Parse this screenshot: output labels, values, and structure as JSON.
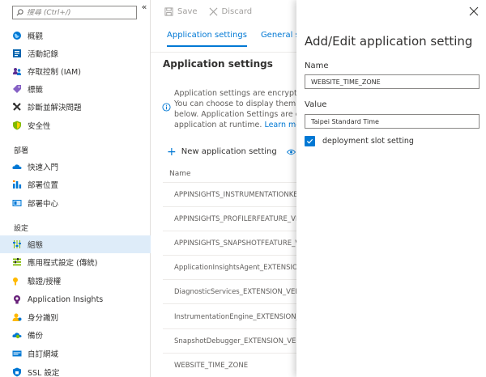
{
  "sidebar": {
    "search_placeholder": "搜尋 (Ctrl+/)",
    "collapse_glyph": "«",
    "section_deploy": "部署",
    "section_settings": "設定",
    "items": [
      {
        "label": "概觀",
        "icon": "globe-icon"
      },
      {
        "label": "活動記錄",
        "icon": "activity-log-icon"
      },
      {
        "label": "存取控制 (IAM)",
        "icon": "people-icon"
      },
      {
        "label": "標籤",
        "icon": "tag-icon"
      },
      {
        "label": "診斷並解決問題",
        "icon": "tools-icon"
      },
      {
        "label": "安全性",
        "icon": "shield-icon"
      },
      {
        "label": "快速入門",
        "icon": "cloud-icon"
      },
      {
        "label": "部署位置",
        "icon": "deployment-slots-icon"
      },
      {
        "label": "部署中心",
        "icon": "deployment-center-icon"
      },
      {
        "label": "組態",
        "icon": "sliders-icon"
      },
      {
        "label": "應用程式設定 (傳統)",
        "icon": "app-settings-icon"
      },
      {
        "label": "驗證/授權",
        "icon": "key-icon"
      },
      {
        "label": "Application Insights",
        "icon": "lightbulb-icon"
      },
      {
        "label": "身分識別",
        "icon": "identity-icon"
      },
      {
        "label": "備份",
        "icon": "backup-icon"
      },
      {
        "label": "自訂網域",
        "icon": "custom-domain-icon"
      },
      {
        "label": "SSL 設定",
        "icon": "lock-icon"
      }
    ]
  },
  "toolbar": {
    "save_label": "Save",
    "discard_label": "Discard"
  },
  "tabs": {
    "application_settings": "Application settings",
    "general_settings": "General sett"
  },
  "main": {
    "title": "Application settings",
    "info_lines": [
      "Application settings are encrypted",
      "You can choose to display them in",
      "below. Application Settings are exp",
      "application at runtime."
    ],
    "learn_more": "Learn more",
    "new_setting_label": "New application setting",
    "show_label": "Sh",
    "name_column": "Name",
    "rows": [
      "APPINSIGHTS_INSTRUMENTATIONKEY",
      "APPINSIGHTS_PROFILERFEATURE_VERSIO",
      "APPINSIGHTS_SNAPSHOTFEATURE_VERSI",
      "ApplicationInsightsAgent_EXTENSION_VI",
      "DiagnosticServices_EXTENSION_VERSION",
      "InstrumentationEngine_EXTENSION_VERS",
      "SnapshotDebugger_EXTENSION_VERSIO",
      "WEBSITE_TIME_ZONE"
    ]
  },
  "panel": {
    "title": "Add/Edit application setting",
    "name_label": "Name",
    "name_value": "WEBSITE_TIME_ZONE",
    "value_label": "Value",
    "value_value": "Taipei Standard Time",
    "slot_label": "deployment slot setting",
    "slot_checked": true
  },
  "colors": {
    "accent": "#0078d4",
    "active_bg": "#deecf9"
  }
}
